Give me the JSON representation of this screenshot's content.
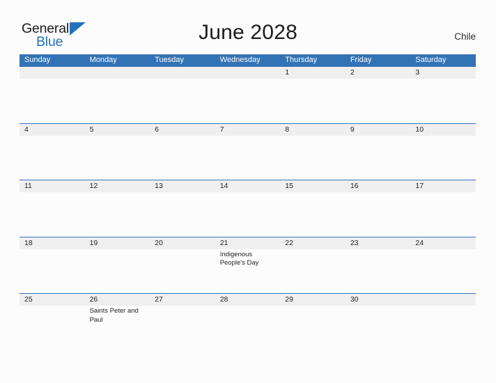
{
  "brand": {
    "name_part1": "General",
    "name_part2": "Blue",
    "triangle_color": "#2272bb"
  },
  "header": {
    "title": "June 2028",
    "country": "Chile"
  },
  "theme": {
    "accent": "#3273b5",
    "band": "#efefef",
    "background": "#fcfcfc",
    "text": "#222222",
    "header_text": "#ffffff"
  },
  "calendar": {
    "month": "June",
    "year": "2028",
    "weekday_headers": [
      "Sunday",
      "Monday",
      "Tuesday",
      "Wednesday",
      "Thursday",
      "Friday",
      "Saturday"
    ],
    "weeks": [
      {
        "days": [
          {
            "num": "",
            "event": ""
          },
          {
            "num": "",
            "event": ""
          },
          {
            "num": "",
            "event": ""
          },
          {
            "num": "",
            "event": ""
          },
          {
            "num": "1",
            "event": ""
          },
          {
            "num": "2",
            "event": ""
          },
          {
            "num": "3",
            "event": ""
          }
        ]
      },
      {
        "days": [
          {
            "num": "4",
            "event": ""
          },
          {
            "num": "5",
            "event": ""
          },
          {
            "num": "6",
            "event": ""
          },
          {
            "num": "7",
            "event": ""
          },
          {
            "num": "8",
            "event": ""
          },
          {
            "num": "9",
            "event": ""
          },
          {
            "num": "10",
            "event": ""
          }
        ]
      },
      {
        "days": [
          {
            "num": "11",
            "event": ""
          },
          {
            "num": "12",
            "event": ""
          },
          {
            "num": "13",
            "event": ""
          },
          {
            "num": "14",
            "event": ""
          },
          {
            "num": "15",
            "event": ""
          },
          {
            "num": "16",
            "event": ""
          },
          {
            "num": "17",
            "event": ""
          }
        ]
      },
      {
        "days": [
          {
            "num": "18",
            "event": ""
          },
          {
            "num": "19",
            "event": ""
          },
          {
            "num": "20",
            "event": ""
          },
          {
            "num": "21",
            "event": "Indigenous People's Day"
          },
          {
            "num": "22",
            "event": ""
          },
          {
            "num": "23",
            "event": ""
          },
          {
            "num": "24",
            "event": ""
          }
        ]
      },
      {
        "days": [
          {
            "num": "25",
            "event": ""
          },
          {
            "num": "26",
            "event": "Saints Peter and Paul"
          },
          {
            "num": "27",
            "event": ""
          },
          {
            "num": "28",
            "event": ""
          },
          {
            "num": "29",
            "event": ""
          },
          {
            "num": "30",
            "event": ""
          },
          {
            "num": "",
            "event": ""
          }
        ]
      }
    ]
  }
}
